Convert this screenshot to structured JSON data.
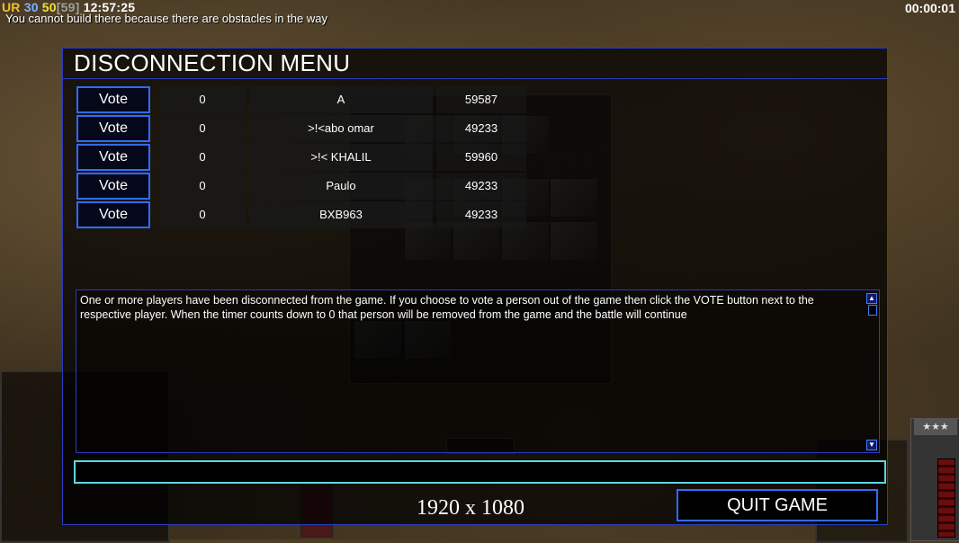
{
  "hud": {
    "ur": "UR",
    "fps": "30",
    "frames": "50",
    "frames_bracket": "[59]",
    "clock": "12:57:25",
    "message": "You cannot build there because there are obstacles in the way",
    "game_timer": "00:00:01"
  },
  "dialog": {
    "title": "DISCONNECTION MENU",
    "players": [
      {
        "vote_label": "Vote",
        "votes": "0",
        "name": "A",
        "ping": "59587"
      },
      {
        "vote_label": "Vote",
        "votes": "0",
        "name": ">!<abo omar",
        "ping": "49233"
      },
      {
        "vote_label": "Vote",
        "votes": "0",
        "name": ">!< KHALIL",
        "ping": "59960"
      },
      {
        "vote_label": "Vote",
        "votes": "0",
        "name": "Paulo",
        "ping": "49233"
      },
      {
        "vote_label": "Vote",
        "votes": "0",
        "name": "BXB963",
        "ping": "49233"
      }
    ],
    "info_text": "One or more players have been disconnected from the game. If you choose to vote a person out of the game then click the VOTE button next to the respective player. When the timer counts down to 0 that person will be removed from the game and the battle will continue",
    "chat_value": "",
    "quit_label": "QUIT GAME"
  },
  "overlay": {
    "resolution": "1920 x 1080"
  },
  "colors": {
    "accent_blue": "#2f6cff",
    "chat_border": "#5ad8e0"
  }
}
